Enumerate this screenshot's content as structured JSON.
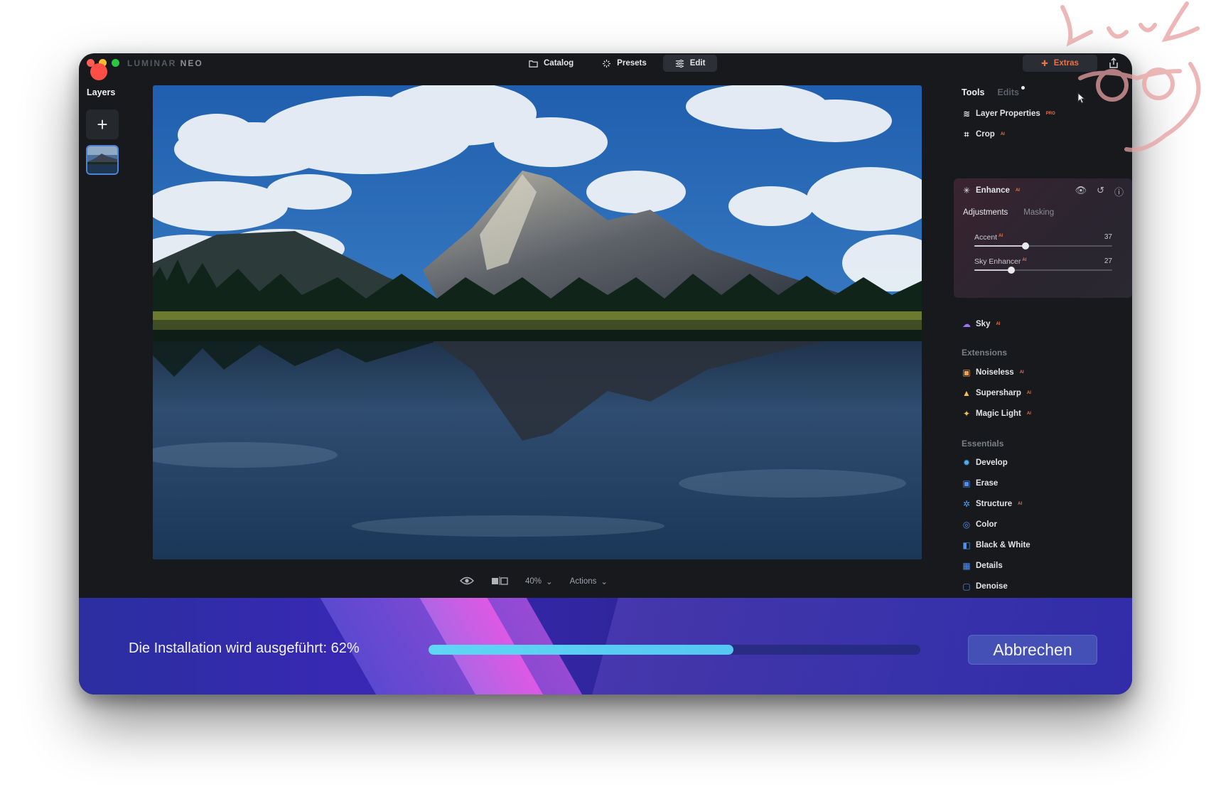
{
  "window": {
    "brand_part1": "LUMINAR",
    "brand_part2": "NEO"
  },
  "topnav": {
    "catalog": "Catalog",
    "presets": "Presets",
    "edit": "Edit",
    "active": "Edit"
  },
  "extras": {
    "label": "Extras"
  },
  "layers": {
    "title": "Layers",
    "add_symbol": "+"
  },
  "viewbar": {
    "zoom": "40%",
    "actions": "Actions"
  },
  "rpanel": {
    "tab_tools": "Tools",
    "tab_edits": "Edits",
    "layer_properties": "Layer Properties",
    "layer_properties_tag": "PRO",
    "crop": "Crop",
    "crop_tag": "AI",
    "enhance": "Enhance",
    "enhance_tag": "AI",
    "sub_adjustments": "Adjustments",
    "sub_masking": "Masking",
    "sliders": [
      {
        "label": "Accent",
        "tag": "AI",
        "value": "37",
        "fraction": 0.37
      },
      {
        "label": "Sky Enhancer",
        "tag": "AI",
        "value": "27",
        "fraction": 0.27
      }
    ],
    "sky": "Sky",
    "sky_tag": "AI",
    "extensions_head": "Extensions",
    "extensions": [
      {
        "label": "Noiseless",
        "tag": "AI",
        "icon": "noiseless-icon"
      },
      {
        "label": "Supersharp",
        "tag": "AI",
        "icon": "supersharp-icon"
      },
      {
        "label": "Magic Light",
        "tag": "AI",
        "icon": "magic-light-icon"
      }
    ],
    "essentials_head": "Essentials",
    "essentials": [
      {
        "label": "Develop",
        "tag": "",
        "icon": "develop-icon"
      },
      {
        "label": "Erase",
        "tag": "",
        "icon": "erase-icon"
      },
      {
        "label": "Structure",
        "tag": "AI",
        "icon": "structure-icon"
      },
      {
        "label": "Color",
        "tag": "",
        "icon": "color-icon"
      },
      {
        "label": "Black & White",
        "tag": "",
        "icon": "black-white-icon"
      },
      {
        "label": "Details",
        "tag": "",
        "icon": "details-icon"
      },
      {
        "label": "Denoise",
        "tag": "",
        "icon": "denoise-icon"
      }
    ]
  },
  "install": {
    "status_text": "Die Installation wird ausgeführt: 62%",
    "progress": 0.62,
    "cancel_label": "Abbrechen"
  },
  "colors": {
    "accent_orange": "#e8734d",
    "progress": "#5fd6f5",
    "install_bg": "#2e2aa8"
  }
}
